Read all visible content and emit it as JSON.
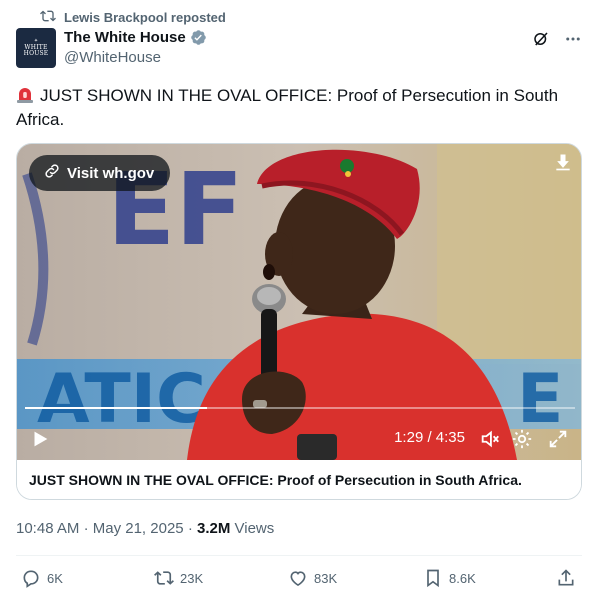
{
  "repost_banner": {
    "text": "Lewis Brackpool reposted",
    "icon": "repost-icon"
  },
  "author": {
    "display_name": "The White House",
    "handle": "@WhiteHouse",
    "verified_color": "#829aab",
    "avatar_lines": [
      "WHITE",
      "HOUSE"
    ]
  },
  "header_actions": {
    "grok_icon": "grok-icon",
    "more_icon": "more-icon"
  },
  "tweet": {
    "emoji": "rotating-light-emoji",
    "text": "JUST SHOWN IN THE OVAL OFFICE: Proof of Persecution in South Africa."
  },
  "video": {
    "visit_label": "Visit wh.gov",
    "timecode": "1:29 / 4:35",
    "progress": 0.33,
    "caption": "JUST SHOWN IN THE OVAL OFFICE: Proof of Persecution in South Africa."
  },
  "meta": {
    "time": "10:48 AM",
    "separator": "·",
    "date": "May 21, 2025",
    "views_count": "3.2M",
    "views_label": "Views"
  },
  "actions": {
    "replies": "6K",
    "reposts": "23K",
    "likes": "83K",
    "bookmarks": "8.6K"
  },
  "colors": {
    "text_primary": "#0f1419",
    "text_secondary": "#536471",
    "border": "#cfd9de",
    "beret_red": "#b81f2a"
  }
}
